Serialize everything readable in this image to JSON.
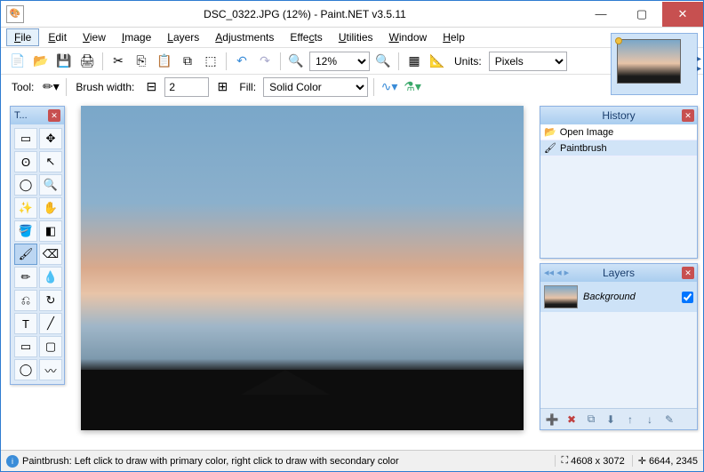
{
  "window": {
    "title": "DSC_0322.JPG (12%) - Paint.NET v3.5.11"
  },
  "menu": {
    "file": "File",
    "edit": "Edit",
    "view": "View",
    "image": "Image",
    "layers": "Layers",
    "adjustments": "Adjustments",
    "effects": "Effects",
    "utilities": "Utilities",
    "window": "Window",
    "help": "Help"
  },
  "toolbar": {
    "zoom_value": "12%",
    "units_label": "Units:",
    "units_value": "Pixels",
    "tool_label": "Tool:",
    "brush_label": "Brush width:",
    "brush_value": "2",
    "fill_label": "Fill:",
    "fill_value": "Solid Color"
  },
  "tools_window": {
    "title": "T..."
  },
  "history": {
    "title": "History",
    "items": [
      "Open Image",
      "Paintbrush"
    ]
  },
  "layers": {
    "title": "Layers",
    "items": [
      {
        "name": "Background",
        "visible": true
      }
    ]
  },
  "status": {
    "hint": "Paintbrush: Left click to draw with primary color, right click to draw with secondary color",
    "dimensions": "4608 x 3072",
    "cursor": "6644, 2345"
  }
}
